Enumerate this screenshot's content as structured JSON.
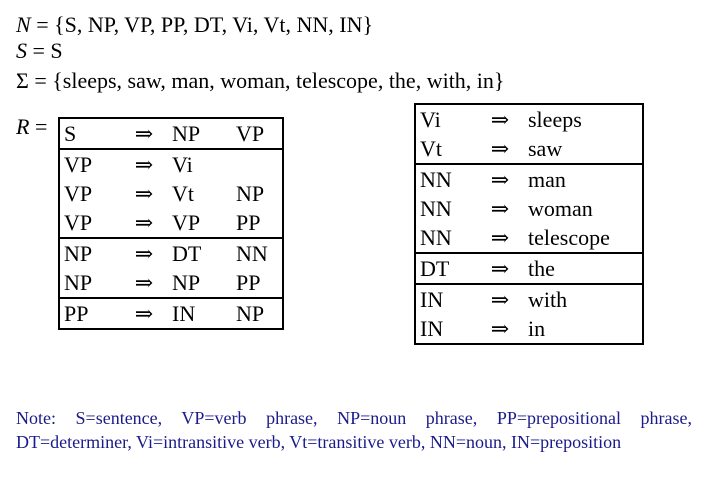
{
  "definitions": {
    "n_symbol": "N",
    "n_rest": " = {S, NP, VP, PP, DT, Vi, Vt, NN, IN}",
    "s_symbol": "S",
    "s_rest": " = S",
    "sigma_symbol": "Σ",
    "sigma_rest": " = {sleeps, saw, man, woman, telescope, the, with, in}",
    "r_symbol": "R",
    "r_rest": " ="
  },
  "arrow": "⇒",
  "left_rules": [
    {
      "lhs": "S",
      "rhs": [
        "NP",
        "VP"
      ],
      "group_start": false
    },
    {
      "lhs": "VP",
      "rhs": [
        "Vi",
        ""
      ],
      "group_start": true
    },
    {
      "lhs": "VP",
      "rhs": [
        "Vt",
        "NP"
      ],
      "group_start": false
    },
    {
      "lhs": "VP",
      "rhs": [
        "VP",
        "PP"
      ],
      "group_start": false
    },
    {
      "lhs": "NP",
      "rhs": [
        "DT",
        "NN"
      ],
      "group_start": true
    },
    {
      "lhs": "NP",
      "rhs": [
        "NP",
        "PP"
      ],
      "group_start": false
    },
    {
      "lhs": "PP",
      "rhs": [
        "IN",
        "NP"
      ],
      "group_start": true
    }
  ],
  "right_rules": [
    {
      "lhs": "Vi",
      "rhs": [
        "sleeps"
      ],
      "group_start": false
    },
    {
      "lhs": "Vt",
      "rhs": [
        "saw"
      ],
      "group_start": false
    },
    {
      "lhs": "NN",
      "rhs": [
        "man"
      ],
      "group_start": true
    },
    {
      "lhs": "NN",
      "rhs": [
        "woman"
      ],
      "group_start": false
    },
    {
      "lhs": "NN",
      "rhs": [
        "telescope"
      ],
      "group_start": false
    },
    {
      "lhs": "DT",
      "rhs": [
        "the"
      ],
      "group_start": true
    },
    {
      "lhs": "IN",
      "rhs": [
        "with"
      ],
      "group_start": true
    },
    {
      "lhs": "IN",
      "rhs": [
        "in"
      ],
      "group_start": false
    }
  ],
  "note": "Note:  S=sentence, VP=verb phrase, NP=noun phrase, PP=prepositional phrase, DT=determiner, Vi=intransitive verb, Vt=transitive verb, NN=noun, IN=preposition",
  "colors": {
    "note_text": "#1a1a8c"
  }
}
